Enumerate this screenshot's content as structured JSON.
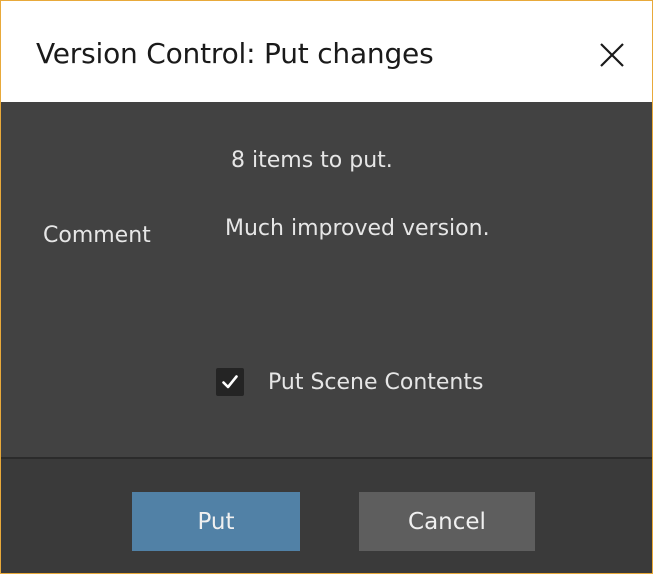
{
  "dialog": {
    "title": "Version Control: Put changes",
    "close_icon": "close-icon"
  },
  "content": {
    "items_info": "8 items to put.",
    "comment_label": "Comment",
    "comment_value": "Much improved version.",
    "put_scene_contents": {
      "label": "Put Scene Contents",
      "checked": true
    }
  },
  "buttons": {
    "put_label": "Put",
    "cancel_label": "Cancel"
  },
  "colors": {
    "accent_border": "#e8a93a",
    "primary_button": "#5181a6",
    "secondary_button": "#5e5e5e",
    "panel": "#424242"
  }
}
